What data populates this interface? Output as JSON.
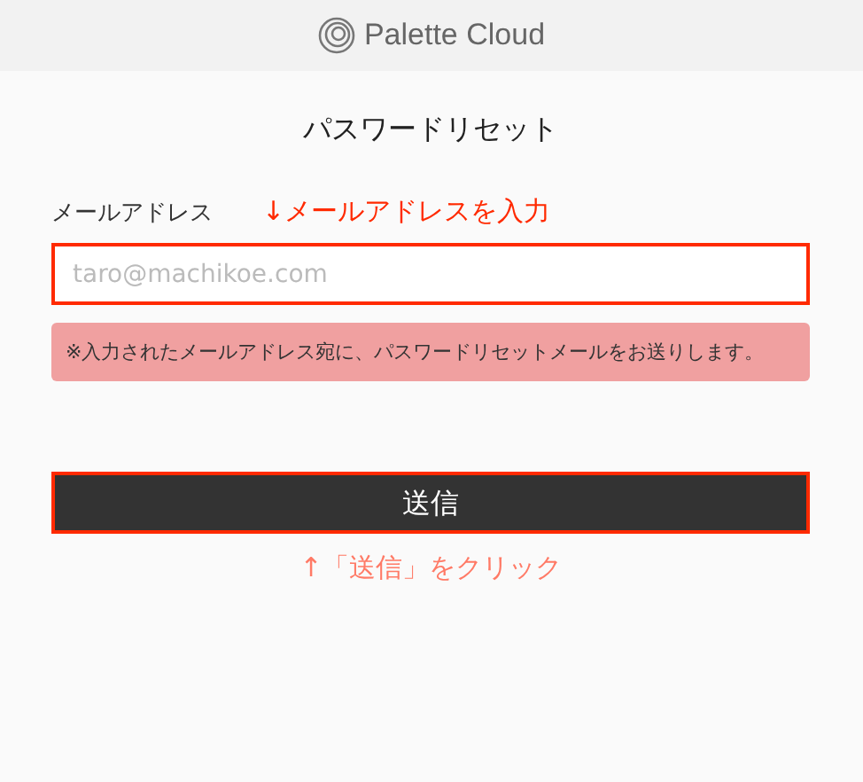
{
  "header": {
    "logo_text": "Palette Cloud"
  },
  "title": "パスワードリセット",
  "email": {
    "label": "メールアドレス",
    "placeholder": "taro@machikoe.com",
    "highlighted": true
  },
  "note": "※入力されたメールアドレス宛に、パスワードリセットメールをお送りします。",
  "submit": {
    "label": "送信",
    "highlighted": true
  },
  "annotations": [
    {
      "text": "↓メールアドレスを入力",
      "color": "#ff2a00"
    },
    {
      "text": "↑「送信」をクリック",
      "color": "#ff7a66"
    }
  ]
}
